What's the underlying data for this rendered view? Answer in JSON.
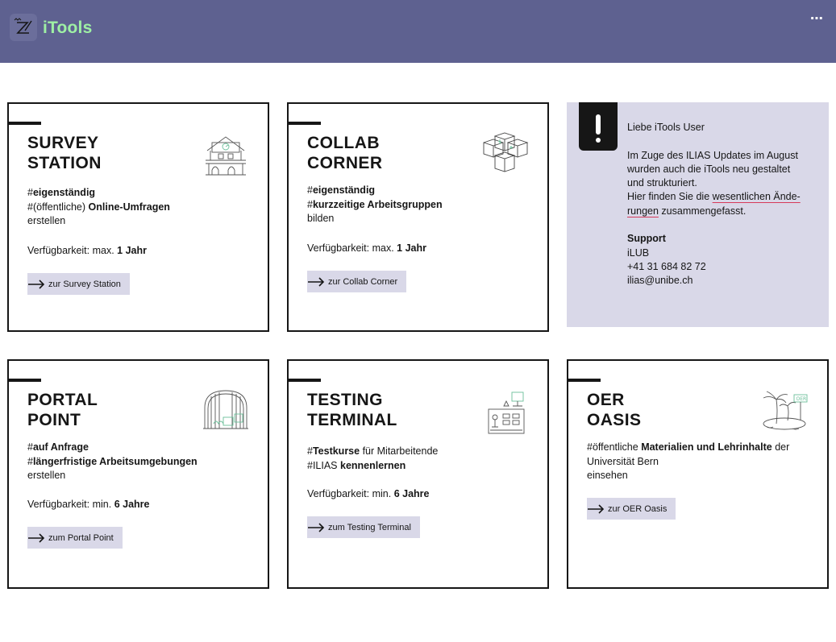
{
  "header": {
    "app_title": "iTools",
    "menu_label": "⋯",
    "logo_icon": "itools-logo-icon",
    "title_color": "#9ef0a4",
    "background_color": "#5e6190"
  },
  "cards": [
    {
      "title_line1": "SURVEY",
      "title_line2": "STATION",
      "desc_line1_prefix": "#",
      "desc_line1_bold": "eigenständig",
      "desc_line2_prefix": "#(öffentliche) ",
      "desc_line2_bold": "Online-Umfragen",
      "desc_line3": "erstellen",
      "avail_prefix": "Verfügbarkeit: max. ",
      "avail_bold": "1 Jahr",
      "button_label": "zur Survey Station",
      "icon": "building-icon"
    },
    {
      "title_line1": "COLLAB",
      "title_line2": "CORNER",
      "desc_line1_prefix": "#",
      "desc_line1_bold": "eigenständig",
      "desc_line2_prefix": "#",
      "desc_line2_bold": "kurzzeitige Arbeitsgruppen",
      "desc_line3": "bilden",
      "avail_prefix": "Verfügbarkeit: max. ",
      "avail_bold": "1 Jahr",
      "button_label": "zur Collab Corner",
      "icon": "cubes-icon"
    },
    {
      "title_line1": "PORTAL",
      "title_line2": "POINT",
      "desc_line1_prefix": "#",
      "desc_line1_bold": "auf Anfrage",
      "desc_line2_prefix": "#",
      "desc_line2_bold": "längerfristige Arbeitsumgebungen",
      "desc_line3": "erstellen",
      "avail_prefix": "Verfügbarkeit: min. ",
      "avail_bold": "6 Jahre",
      "button_label": "zum Portal Point",
      "icon": "portal-icon"
    },
    {
      "title_line1": "TESTING",
      "title_line2": "TERMINAL",
      "desc_line1_prefix": "#",
      "desc_line1_bold": "Testkurse",
      "desc_line1_suffix": " für Mitarbeitende",
      "desc_line2_prefix": "#ILIAS ",
      "desc_line2_bold": "kennenlernen",
      "avail_prefix": "Verfügbarkeit: min. ",
      "avail_bold": "6 Jahre",
      "button_label": "zum Testing Terminal",
      "icon": "terminal-icon"
    },
    {
      "title_line1": "OER",
      "title_line2": "OASIS",
      "desc_line1_prefix": "#öffentliche ",
      "desc_line1_bold": "Materialien und Lehrinhalte",
      "desc_line1_suffix": " der",
      "desc_line2": "Universität Bern",
      "desc_line3": "einsehen",
      "button_label": "zur OER Oasis",
      "icon_sign_text": "OER",
      "icon": "island-icon"
    }
  ],
  "info": {
    "greeting": "Liebe iTools User",
    "para_line1": "Im Zuge des ILIAS Updates im August",
    "para_line2": "wurden auch die iTools neu gestaltet",
    "para_line3": "und strukturiert.",
    "para_line4_prefix": "Hier finden Sie die ",
    "link_part1": "wesentlichen Ände-",
    "link_part2": "rungen",
    "para_line5_suffix": " zusammengefasst.",
    "support_heading": "Support",
    "support_org": "iLUB",
    "support_phone": "+41 31 684 82 72",
    "support_email": "ilias@unibe.ch",
    "icon": "exclamation-icon",
    "background_color": "#d9d8e8"
  }
}
